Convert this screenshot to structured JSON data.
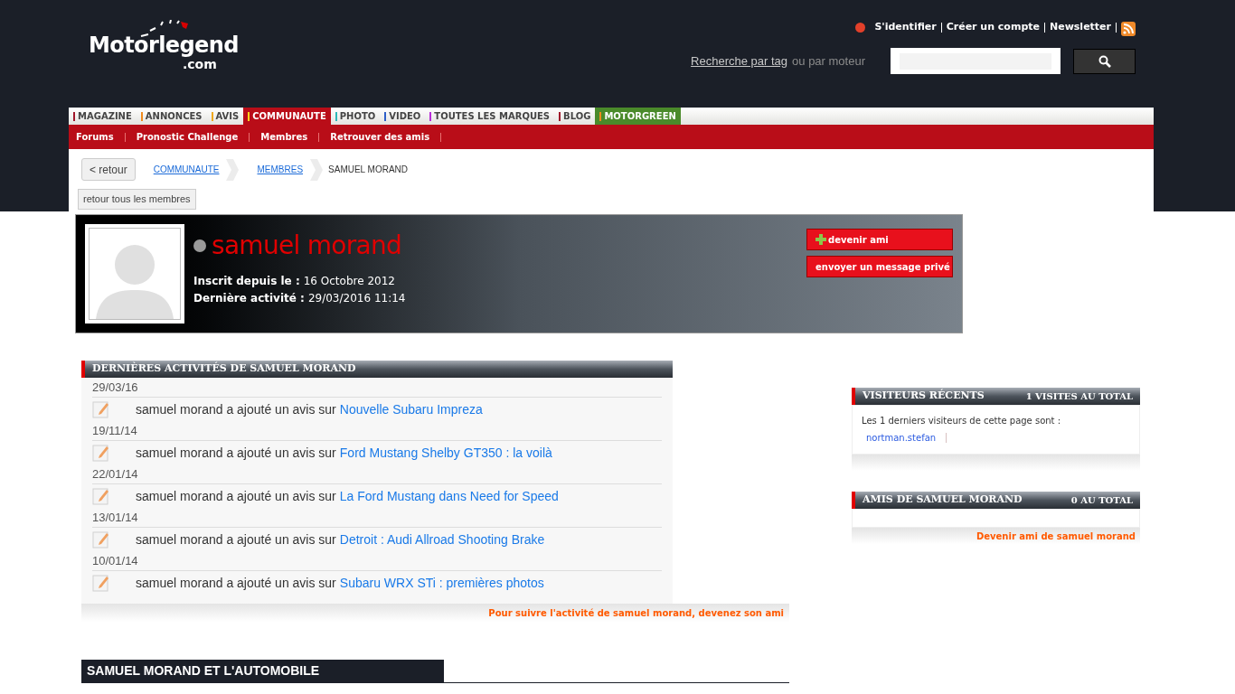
{
  "logo": {
    "main": "Motorlegend",
    "sub": ".com"
  },
  "top_links": [
    "S'identifier",
    "Créer un compte",
    "Newsletter"
  ],
  "search": {
    "tag_link": "Recherche par tag",
    "tail": "ou par moteur"
  },
  "nav": [
    {
      "label": "MAGAZINE",
      "color": "#a0162a",
      "selected": false
    },
    {
      "label": "ANNONCES",
      "color": "#f08a1c",
      "selected": false
    },
    {
      "label": "AVIS",
      "color": "#f0a81c",
      "selected": false
    },
    {
      "label": "COMMUNAUTE",
      "color": "#ffd21c",
      "selected": true
    },
    {
      "label": "PHOTO",
      "color": "#2cb8b8",
      "selected": false
    },
    {
      "label": "VIDEO",
      "color": "#2d5fc8",
      "selected": false
    },
    {
      "label": "TOUTES LES MARQUES",
      "color": "#b82cd8",
      "selected": false
    },
    {
      "label": "BLOG",
      "color": "#a0162a",
      "selected": false
    },
    {
      "label": "MOTORGREEN",
      "color": "#f08a1c",
      "selected": false,
      "kind": "green"
    }
  ],
  "subnav": [
    "Forums",
    "Pronostic Challenge",
    "Membres",
    "Retrouver des amis"
  ],
  "back_button": "< retour",
  "breadcrumb": [
    {
      "label": "COMMUNAUTE",
      "kind": "link"
    },
    {
      "label": "MEMBRES",
      "kind": "link"
    },
    {
      "label": "SAMUEL MORAND",
      "kind": "current"
    }
  ],
  "all_members_button": "retour tous les membres",
  "profile": {
    "name": "samuel morand",
    "online": false,
    "fields": [
      {
        "label": "Inscrit depuis le :",
        "value": "16 Octobre 2012"
      },
      {
        "label": "Dernière activité :",
        "value": "29/03/2016 11:14"
      }
    ],
    "buttons": [
      {
        "label": "devenir ami",
        "kind": "add"
      },
      {
        "label": "envoyer un message privé",
        "kind": "plain"
      }
    ]
  },
  "activities": {
    "title": "DERNIÈRES ACTIVITÉS DE SAMUEL MORAND",
    "items": [
      {
        "date": "29/03/16",
        "text": "samuel morand a ajouté un avis sur",
        "link": "Nouvelle Subaru Impreza"
      },
      {
        "date": "19/11/14",
        "text": "samuel morand a ajouté un avis sur",
        "link": "Ford Mustang Shelby GT350 : la voilà"
      },
      {
        "date": "22/01/14",
        "text": "samuel morand a ajouté un avis sur",
        "link": "La Ford Mustang dans Need for Speed"
      },
      {
        "date": "13/01/14",
        "text": "samuel morand a ajouté un avis sur",
        "link": "Detroit : Audi Allroad Shooting Brake"
      },
      {
        "date": "10/01/14",
        "text": "samuel morand a ajouté un avis sur",
        "link": "Subaru WRX STi : premières photos"
      }
    ],
    "footer": "Pour suivre l'activité de samuel morand, devenez son ami"
  },
  "auto_section": {
    "title": "SAMUEL MORAND ET L'AUTOMOBILE"
  },
  "visitors": {
    "title": "VISITEURS RÉCENTS",
    "count": "1 VISITES AU TOTAL",
    "intro": "Les 1 derniers visiteurs de cette page sont :",
    "names": [
      "nortman.stefan"
    ]
  },
  "friends": {
    "title": "AMIS DE SAMUEL MORAND",
    "count": "0 AU TOTAL",
    "footer": "Devenir ami de samuel morand"
  }
}
